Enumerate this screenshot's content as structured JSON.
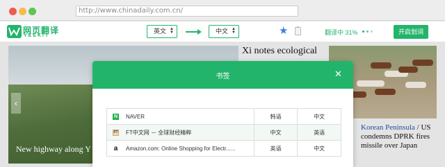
{
  "browser": {
    "url": "http://www.chinadaily.com.cn/"
  },
  "toolbar": {
    "logo_cn": "网页翻译",
    "logo_en": "YEEKIT",
    "source_lang": "英文",
    "target_lang": "中文",
    "progress_text": "翻译中 31%",
    "start_button": "开启划词",
    "accent_color": "#23b46b"
  },
  "page": {
    "left_caption": "New highway along Y",
    "headline": "Xi notes ecological",
    "news_link": "Korean Peninsula",
    "news_title_rest": " / US condemns DPRK fires missile over Japan"
  },
  "modal": {
    "title": "书签",
    "rows": [
      {
        "name": "NAVER",
        "icon": "naver-icon",
        "from": "韩语",
        "to": "中文"
      },
      {
        "name": "FT中文网 － 全球财经精粹",
        "icon": "ft-icon",
        "from": "中文",
        "to": "英语"
      },
      {
        "name": "Amazon.com: Online Shopping for Electr......",
        "icon": "amazon-icon",
        "from": "英语",
        "to": "中文"
      }
    ]
  }
}
